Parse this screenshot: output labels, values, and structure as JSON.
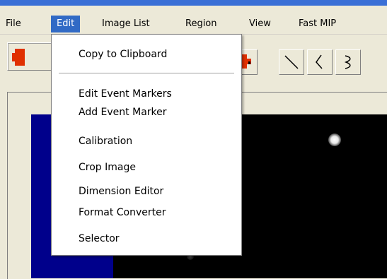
{
  "menubar": {
    "items": [
      {
        "label": "File"
      },
      {
        "label": "Edit",
        "active": true
      },
      {
        "label": "Image List"
      },
      {
        "label": "Region"
      },
      {
        "label": "View"
      },
      {
        "label": "Fast MIP"
      }
    ]
  },
  "edit_menu": {
    "items": [
      {
        "label": "Copy to Clipboard"
      },
      {
        "label": "Edit Event Markers"
      },
      {
        "label": "Add Event Marker"
      },
      {
        "label": "Calibration"
      },
      {
        "label": "Crop Image"
      },
      {
        "label": "Dimension Editor"
      },
      {
        "label": "Format Converter"
      },
      {
        "label": "Selector"
      }
    ]
  },
  "toolbar": {
    "icons": [
      "hand-icon",
      "crosshair-icon",
      "line-tool-icon",
      "zigzag-tool-icon",
      "curve-tool-icon"
    ]
  },
  "colors": {
    "menu_highlight": "#316ac5",
    "image_blue": "#00008b",
    "image_black": "#000000",
    "tool_red": "#e03000"
  }
}
